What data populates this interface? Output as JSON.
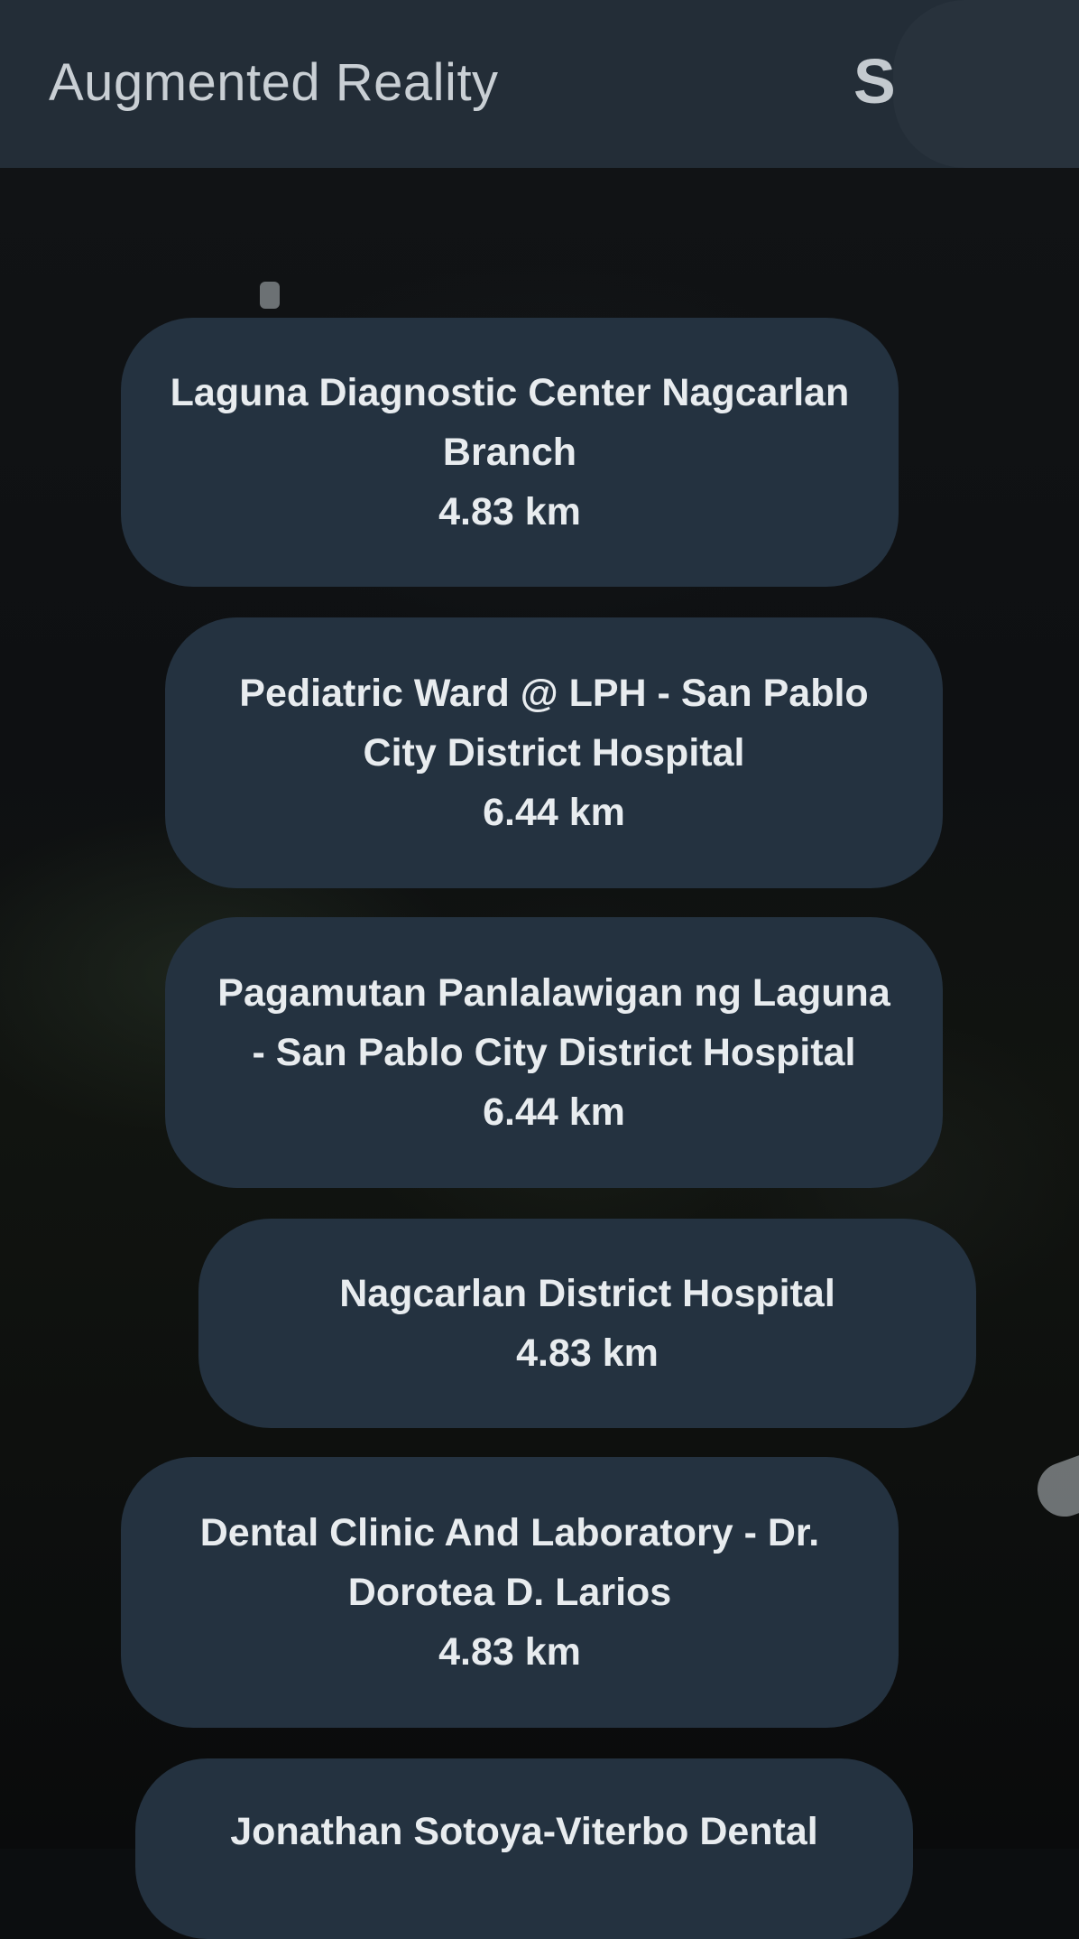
{
  "appbar": {
    "title": "Augmented Reality",
    "action_label": "S"
  },
  "places": [
    {
      "name": "Laguna Diagnostic Center Nagcarlan Branch",
      "distance": "4.83 km"
    },
    {
      "name": "Pediatric Ward @ LPH - San Pablo City District Hospital",
      "distance": "6.44 km"
    },
    {
      "name": "Pagamutan Panlalawigan ng Laguna - San Pablo City District Hospital",
      "distance": "6.44 km"
    },
    {
      "name": "Nagcarlan District Hospital",
      "distance": "4.83 km"
    },
    {
      "name": "Dental Clinic And Laboratory - Dr. Dorotea D. Larios",
      "distance": "4.83 km"
    },
    {
      "name": "Jonathan Sotoya-Viterbo Dental",
      "distance": ""
    }
  ],
  "colors": {
    "appbar": "#232d37",
    "card": "#243240",
    "card_text": "#e8ecef",
    "title_text": "#c9cfd4"
  }
}
